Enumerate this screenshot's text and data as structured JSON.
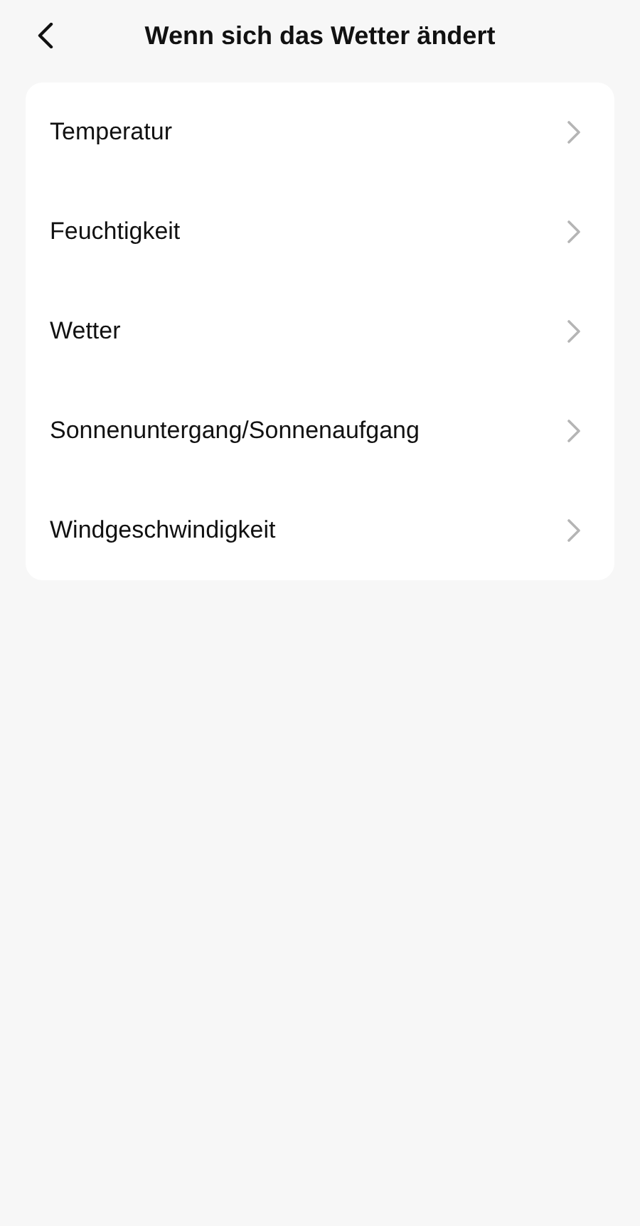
{
  "header": {
    "title": "Wenn sich das Wetter ändert"
  },
  "items": [
    {
      "label": "Temperatur"
    },
    {
      "label": "Feuchtigkeit"
    },
    {
      "label": "Wetter"
    },
    {
      "label": "Sonnenuntergang/Sonnenaufgang"
    },
    {
      "label": "Windgeschwindigkeit"
    }
  ]
}
